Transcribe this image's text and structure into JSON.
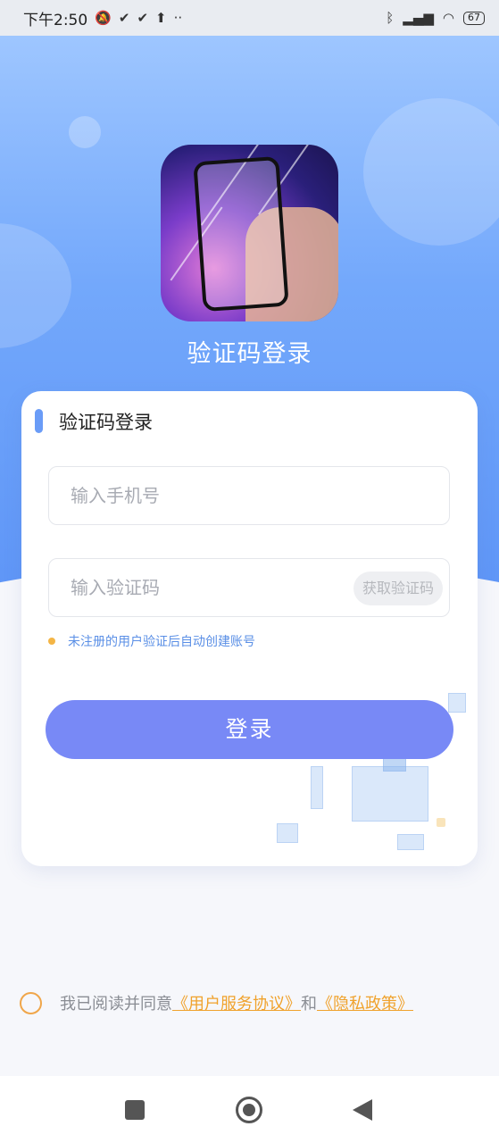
{
  "status_bar": {
    "time": "下午2:50",
    "battery": "67"
  },
  "header": {
    "title": "验证码登录"
  },
  "card": {
    "title": "验证码登录",
    "phone_placeholder": "输入手机号",
    "code_placeholder": "输入验证码",
    "get_code_label": "获取验证码",
    "hint": "未注册的用户验证后自动创建账号",
    "login_label": "登录"
  },
  "agreement": {
    "prefix": "我已阅读并同意",
    "user_agreement": "《用户服务协议》",
    "conjunction": "和",
    "privacy_policy": "《隐私政策》"
  },
  "icons": {
    "status": [
      "silent-icon",
      "check-icon",
      "check-icon",
      "upload-icon",
      "more-icon",
      "bluetooth-icon",
      "signal-icon",
      "wifi-icon",
      "battery-icon"
    ],
    "nav": [
      "recent-apps-icon",
      "home-icon",
      "back-icon"
    ]
  },
  "colors": {
    "accent": "#7889f6",
    "hero": "#73a8fb",
    "link": "#f0a22c",
    "hint": "#5a8fe6"
  }
}
